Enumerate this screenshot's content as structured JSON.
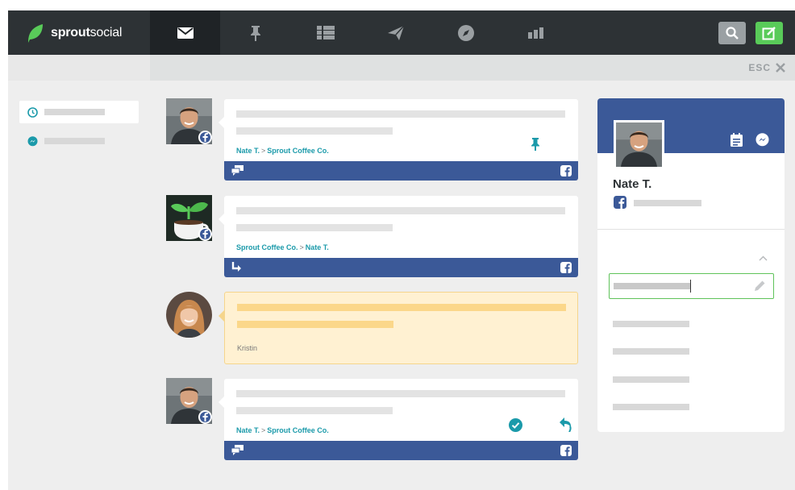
{
  "app": {
    "brand_bold": "sprout",
    "brand_light": "social",
    "brand_color": "#59cb59"
  },
  "nav": {
    "tabs": [
      {
        "name": "messages-tab",
        "icon": "envelope-icon",
        "active": true
      },
      {
        "name": "tasks-tab",
        "icon": "pin-icon",
        "active": false
      },
      {
        "name": "feeds-tab",
        "icon": "list-icon",
        "active": false
      },
      {
        "name": "publishing-tab",
        "icon": "paper-plane-icon",
        "active": false
      },
      {
        "name": "discovery-tab",
        "icon": "compass-icon",
        "active": false
      },
      {
        "name": "reports-tab",
        "icon": "bar-chart-icon",
        "active": false
      }
    ],
    "search_icon": "search-icon",
    "compose_icon": "compose-icon"
  },
  "subbar": {
    "esc_label": "ESC"
  },
  "filters": [
    {
      "icon": "clock-icon",
      "selected": true
    },
    {
      "icon": "messenger-icon",
      "selected": false
    }
  ],
  "messages": [
    {
      "from": "Nate T.",
      "to": "Sprout Coffee Co.",
      "network": "facebook",
      "pinned": true,
      "footer_icon": "thread-icon"
    },
    {
      "from": "Sprout Coffee Co.",
      "to": "Nate T.",
      "network": "facebook",
      "footer_icon": "reply-arrow-icon"
    },
    {
      "author": "Kristin",
      "type": "note"
    },
    {
      "from": "Nate T.",
      "to": "Sprout Coffee Co.",
      "network": "facebook",
      "completed": true,
      "footer_icon": "thread-icon"
    }
  ],
  "profile": {
    "name": "Nate T.",
    "network": "facebook"
  },
  "colors": {
    "facebook": "#3b5998",
    "teal": "#1b9aaa",
    "green": "#59cb59",
    "topbar": "#2d3235"
  }
}
